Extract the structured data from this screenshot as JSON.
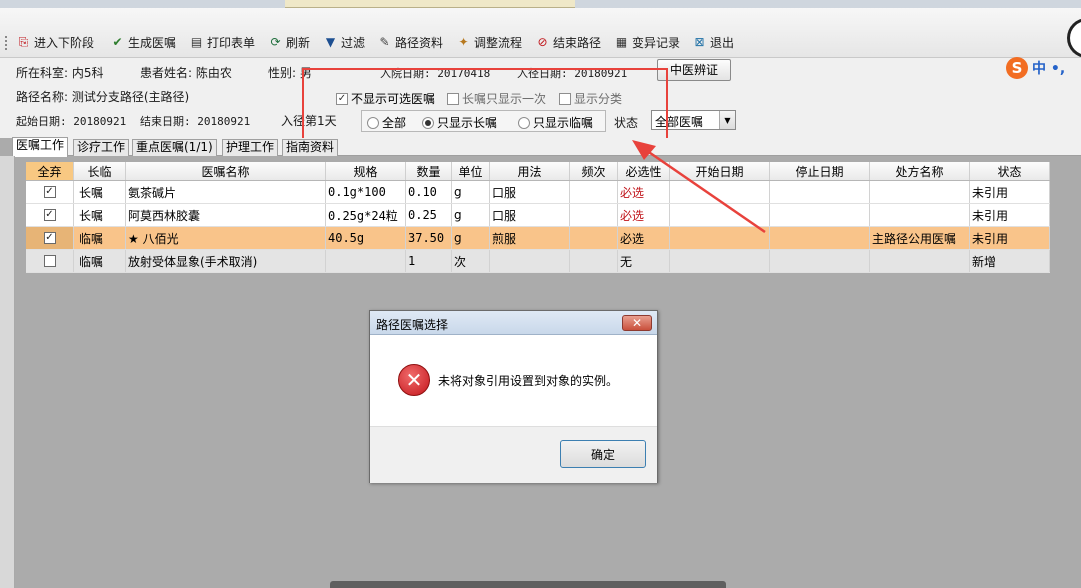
{
  "toolbar": {
    "buttons": [
      {
        "label": "进入下阶段",
        "icon": "next-stage-icon"
      },
      {
        "label": "生成医嘱",
        "icon": "generate-order-icon"
      },
      {
        "label": "打印表单",
        "icon": "printer-icon"
      },
      {
        "label": "刷新",
        "icon": "refresh-icon"
      },
      {
        "label": "过滤",
        "icon": "filter-icon"
      },
      {
        "label": "路径资料",
        "icon": "path-doc-icon"
      },
      {
        "label": "调整流程",
        "icon": "adjust-flow-icon"
      },
      {
        "label": "结束路径",
        "icon": "end-path-icon"
      },
      {
        "label": "变异记录",
        "icon": "variance-record-icon"
      },
      {
        "label": "退出",
        "icon": "exit-icon"
      }
    ]
  },
  "patient": {
    "dept": "所在科室: 内5科",
    "name": "患者姓名: 陈由农",
    "gender": "性别: 男",
    "admit_date": "入院日期: 20170418",
    "path_in_date": "入径日期: 20180921",
    "path_name": "路径名称: 测试分支路径(主路径)",
    "start_date": "起始日期: 20180921",
    "end_date": "结束日期: 20180921",
    "day_in_path": "入径第1天"
  },
  "tcm_button": "中医辨证",
  "options": {
    "hide_optional": "不显示可选医嘱",
    "long_once": "长嘱只显示一次",
    "show_category": "显示分类",
    "radio_all": "全部",
    "radio_long": "只显示长嘱",
    "radio_temp": "只显示临嘱",
    "status_label": "状态",
    "status_value": "全部医嘱"
  },
  "ime": {
    "text": "中 •,"
  },
  "tabs": [
    "医嘱工作",
    "诊疗工作",
    "重点医嘱(1/1)",
    "护理工作",
    "指南资料"
  ],
  "grid": {
    "headers": [
      "全弃",
      "长临",
      "医嘱名称",
      "规格",
      "数量",
      "单位",
      "用法",
      "频次",
      "必选性",
      "开始日期",
      "停止日期",
      "处方名称",
      "状态"
    ],
    "rows": [
      {
        "checked": true,
        "type": "长嘱",
        "name": "氨茶碱片",
        "spec": "0.1g*100",
        "qty": "0.10",
        "unit": "g",
        "usage": "口服",
        "freq": "",
        "required": "必选",
        "start": "",
        "stop": "",
        "rx": "",
        "status": "未引用"
      },
      {
        "checked": true,
        "type": "长嘱",
        "name": "阿莫西林胶囊",
        "spec": "0.25g*24粒",
        "qty": "0.25",
        "unit": "g",
        "usage": "口服",
        "freq": "",
        "required": "必选",
        "start": "",
        "stop": "",
        "rx": "",
        "status": "未引用"
      },
      {
        "checked": true,
        "type": "临嘱",
        "name": "★ 八佰光",
        "spec": "40.5g",
        "qty": "37.50",
        "unit": "g",
        "usage": "煎服",
        "freq": "",
        "required": "必选",
        "start": "",
        "stop": "",
        "rx": "主路径公用医嘱",
        "status": "未引用"
      },
      {
        "checked": false,
        "type": "临嘱",
        "name": "放射受体显象(手术取消)",
        "spec": "",
        "qty": "1",
        "unit": "次",
        "usage": "",
        "freq": "",
        "required": "无",
        "start": "",
        "stop": "",
        "rx": "",
        "status": "新增"
      }
    ]
  },
  "dialog": {
    "title": "路径医嘱选择",
    "close": "✕",
    "message": "未将对象引用设置到对象的实例。",
    "ok": "确定"
  },
  "colors": {
    "highlight_box": "#e8423c",
    "selected_row": "#f9c48a",
    "required_red": "#c0141a"
  }
}
